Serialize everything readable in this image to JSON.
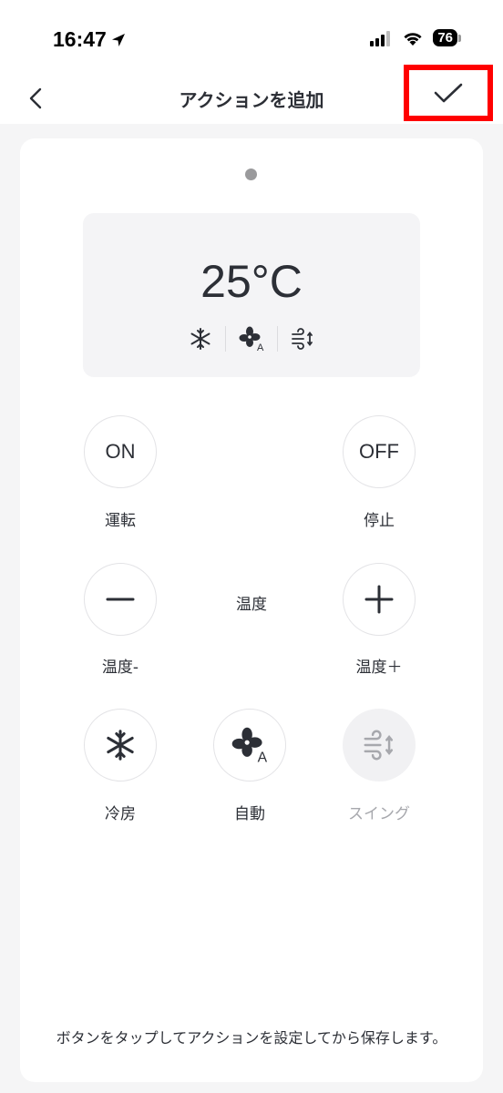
{
  "status": {
    "time": "16:47",
    "battery": "76"
  },
  "nav": {
    "title": "アクションを追加"
  },
  "display": {
    "temperature": "25°C",
    "mode_icons": [
      "snowflake-icon",
      "fan-auto-icon",
      "swing-icon"
    ]
  },
  "buttons": {
    "on": {
      "text": "ON",
      "label": "運転"
    },
    "off": {
      "text": "OFF",
      "label": "停止"
    },
    "temp_down": {
      "label": "温度-"
    },
    "temp_center": "温度",
    "temp_up": {
      "label": "温度＋"
    },
    "cool": {
      "label": "冷房"
    },
    "auto": {
      "label": "自動"
    },
    "swing": {
      "label": "スイング"
    }
  },
  "hint": "ボタンをタップしてアクションを設定してから保存します。"
}
